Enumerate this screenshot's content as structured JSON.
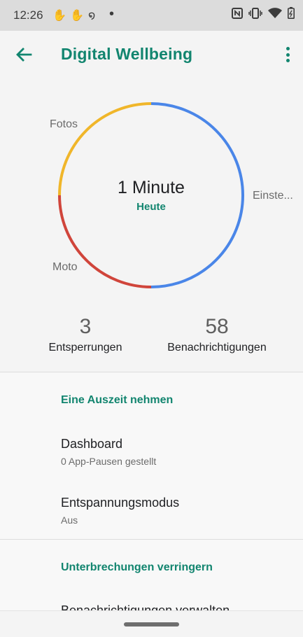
{
  "status_bar": {
    "time": "12:26",
    "notification_icons": [
      "hand-icon",
      "hand-icon",
      "swirl-icon",
      "dot-icon"
    ],
    "right_icons": [
      "nfc-icon",
      "vibrate-icon",
      "wifi-icon",
      "battery-icon"
    ]
  },
  "app_bar": {
    "title": "Digital Wellbeing",
    "back_icon": "arrow-left-icon",
    "overflow_icon": "more-vert-icon"
  },
  "chart_data": {
    "type": "pie",
    "style": "donut",
    "categories": [
      "Einste...",
      "Moto",
      "Fotos"
    ],
    "values": [
      50,
      25,
      25
    ],
    "colors": [
      "#4a86e8",
      "#d0453b",
      "#f0b62a"
    ],
    "center_label": "1 Minute",
    "center_sublabel": "Heute"
  },
  "stats": [
    {
      "value": "3",
      "label": "Entsperrungen"
    },
    {
      "value": "58",
      "label": "Benachrichtigungen"
    }
  ],
  "sections": [
    {
      "header": "Eine Auszeit nehmen",
      "items": [
        {
          "title": "Dashboard",
          "subtitle": "0 App-Pausen gestellt"
        },
        {
          "title": "Entspannungsmodus",
          "subtitle": "Aus"
        }
      ]
    },
    {
      "header": "Unterbrechungen verringern",
      "items": [
        {
          "title": "Benachrichtigungen verwalten",
          "subtitle": ""
        }
      ]
    }
  ],
  "colors": {
    "accent": "#12856f",
    "status_bar_bg": "#dcdcdc",
    "page_bg": "#f4f4f4"
  }
}
